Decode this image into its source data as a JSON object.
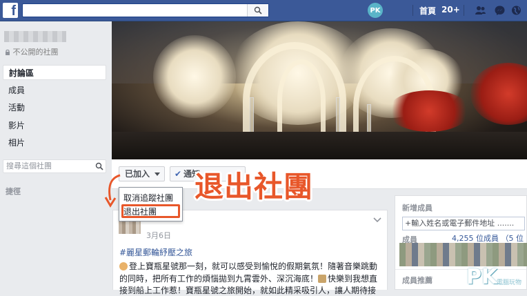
{
  "topbar": {
    "logo": "f",
    "avatar_text": "PK",
    "home_label": "首頁",
    "notification_count": "20+",
    "icons": [
      "friends-icon",
      "messages-icon",
      "globe-icon"
    ]
  },
  "group": {
    "privacy_label": "不公開的社團"
  },
  "nav": {
    "items": [
      "討論區",
      "成員",
      "活動",
      "影片",
      "相片"
    ],
    "active_index": 0,
    "search_placeholder": "搜尋這個社團",
    "shortcuts_label": "捷徑"
  },
  "actions": {
    "joined_label": "已加入",
    "notify_label": "通知",
    "dropdown_items": [
      "取消追蹤社團",
      "退出社團"
    ]
  },
  "annotation": {
    "text": "退出社團",
    "color": "#e8572a"
  },
  "post": {
    "date": "3月6日",
    "hashtag": "#麗星郵輪紓壓之旅",
    "lines": [
      "登上寶瓶星號那一刻，就可以感受到愉悅的假期氣氛！隨著音樂跳動",
      "的同時，把所有工作的煩惱拋到九霄雲外、深沉海底！",
      "快樂到我想直",
      "接到船上工作惹！寶瓶星號之旅開始，就如此精采吸引人，讓人期待接"
    ]
  },
  "right_panel": {
    "new_members_title": "新增成員",
    "add_member_placeholder": "+輸入姓名或電子郵件地址 .......",
    "members_title": "成員",
    "members_count": "4,255 位成員 （5 位",
    "suggest_title": "成員推薦"
  },
  "watermark": {
    "letters": "PK",
    "subtitle": "電腦玩物"
  },
  "colors": {
    "facebook_blue": "#3b5998",
    "link_blue": "#365899",
    "highlight_orange": "#e8572a"
  }
}
